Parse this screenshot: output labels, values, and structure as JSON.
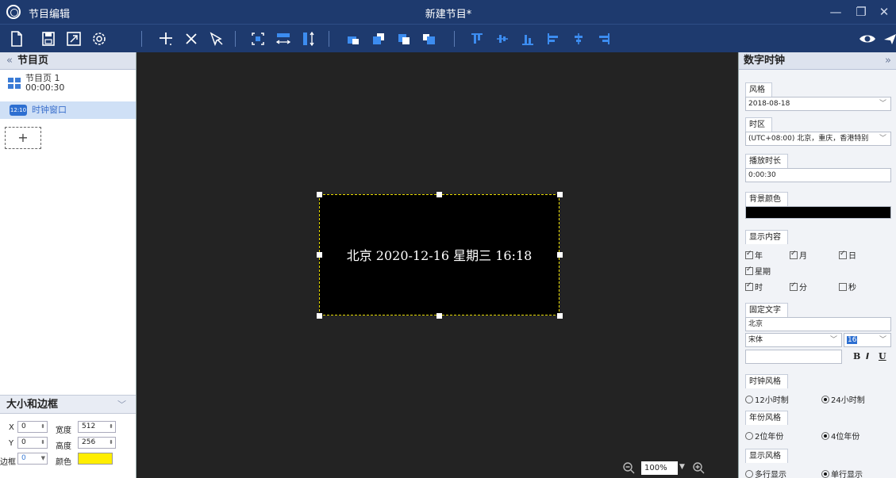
{
  "titlebar": {
    "app_name": "节目编辑",
    "doc_title": "新建节目*",
    "minimize": "—",
    "restore": "❐",
    "close": "✕"
  },
  "toolbar": {
    "icons": [
      "new-file-icon",
      "save-icon",
      "resize-icon",
      "settings-icon",
      "add-icon",
      "delete-icon",
      "select-icon",
      "fit-screen-icon",
      "flip-horizontal-icon",
      "flip-vertical-icon",
      "layer-bottom-icon",
      "layer-down-icon",
      "layer-up-icon",
      "layer-top-icon",
      "align-top-icon",
      "align-vcenter-icon",
      "align-bottom-icon",
      "align-left-icon",
      "align-hcenter-icon",
      "align-right-icon",
      "preview-icon"
    ]
  },
  "left": {
    "header": "节目页",
    "page": {
      "name": "节目页 1",
      "duration": "00:00:30"
    },
    "window": {
      "icon_text": "12:10",
      "label": "时钟窗口"
    },
    "add": "+",
    "size": {
      "header": "大小和边框",
      "x_label": "X",
      "x": "0",
      "y_label": "Y",
      "y": "0",
      "width_label": "宽度",
      "width": "512",
      "height_label": "高度",
      "height": "256",
      "border_label": "边框",
      "border": "0",
      "color_label": "颜色",
      "color_value": "#ffee00"
    }
  },
  "canvas": {
    "clock_text": "北京 2020-12-16 星期三 16:18",
    "zoom": "100%"
  },
  "right": {
    "header": "数字时钟",
    "style": {
      "label": "风格",
      "value": "2018-08-18"
    },
    "timezone": {
      "label": "时区",
      "value": "(UTC+08:00) 北京，重庆，香港特别"
    },
    "duration": {
      "label": "播放时长",
      "value": "0:00:30"
    },
    "bg": {
      "label": "背景颜色",
      "value": "#000000"
    },
    "content": {
      "label": "显示内容",
      "year": "年",
      "month": "月",
      "day": "日",
      "week": "星期",
      "hour": "时",
      "minute": "分",
      "second": "秒"
    },
    "fixed": {
      "label": "固定文字",
      "text": "北京",
      "font": "宋体",
      "size": "16",
      "bold": "B",
      "italic": "I",
      "underline": "U"
    },
    "clock_style": {
      "label": "时钟风格",
      "opt12": "12小时制",
      "opt24": "24小时制"
    },
    "year_style": {
      "label": "年份风格",
      "opt2": "2位年份",
      "opt4": "4位年份"
    },
    "display_style": {
      "label": "显示风格",
      "multi": "多行显示",
      "single": "单行显示"
    }
  }
}
